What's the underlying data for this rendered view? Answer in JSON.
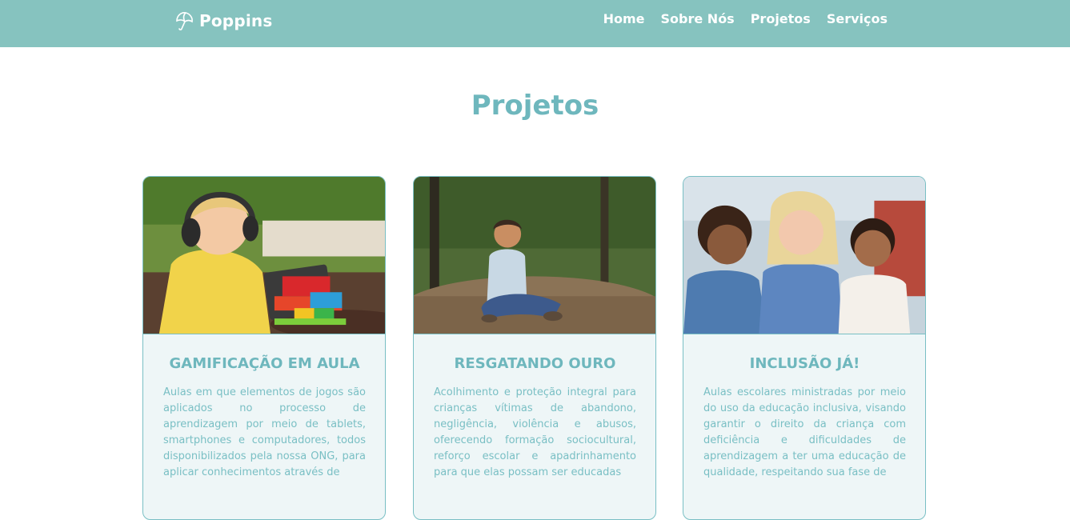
{
  "brand": {
    "name": "Poppins",
    "logo_icon": "umbrella-icon"
  },
  "nav": {
    "items": [
      {
        "label": "Home"
      },
      {
        "label": "Sobre Nós"
      },
      {
        "label": "Projetos"
      },
      {
        "label": "Serviços"
      }
    ]
  },
  "page": {
    "title": "Projetos"
  },
  "colors": {
    "navbar": "#86c3bf",
    "accent": "#6eb7bd",
    "card_bg": "#eef6f7",
    "card_border": "#79bfc4"
  },
  "cards": [
    {
      "title": "GAMIFICAÇÃO EM AULA",
      "text": "Aulas em que elementos de jogos são aplicados no processo de aprendizagem por meio de tablets, smartphones e computadores, todos disponibilizados pela nossa ONG, para aplicar conhecimentos através de"
    },
    {
      "title": "RESGATANDO OURO",
      "text": "Acolhimento e proteção integral para crianças vítimas de abandono, negligência, violência e abusos, oferecendo formação sociocultural, reforço escolar e apadrinhamento para que elas possam ser educadas"
    },
    {
      "title": "INCLUSÃO JÁ!",
      "text": "Aulas escolares ministradas por meio do uso da educação inclusiva, visando garantir o direito da criança com deficiência e dificuldades de aprendizagem a ter uma educação de qualidade, respeitando sua fase de"
    }
  ]
}
